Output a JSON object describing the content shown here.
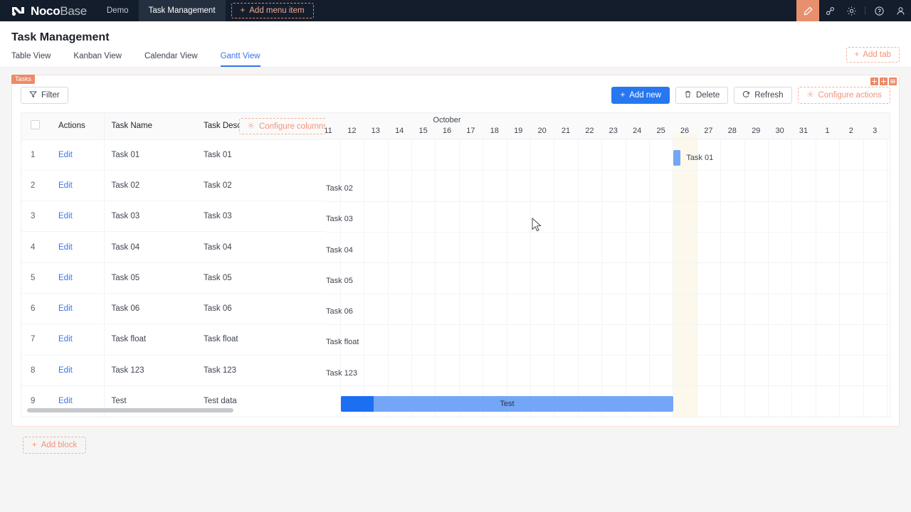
{
  "topnav": {
    "logo_primary": "Noco",
    "logo_secondary": "Base",
    "items": [
      {
        "label": "Demo",
        "active": false
      },
      {
        "label": "Task Management",
        "active": true
      }
    ],
    "add_menu_item": "Add menu item",
    "icons": [
      {
        "name": "design-pen-icon",
        "glyph": "✎",
        "highlighted": true
      },
      {
        "name": "plugin-icon",
        "glyph": "⚒",
        "highlighted": false
      },
      {
        "name": "gear-icon",
        "glyph": "⚙",
        "highlighted": false
      },
      {
        "name": "help-circle-icon",
        "glyph": "?",
        "highlighted": false
      },
      {
        "name": "user-avatar-icon",
        "glyph": "⚹",
        "highlighted": false
      }
    ]
  },
  "page": {
    "title": "Task Management",
    "tabs": [
      {
        "label": "Table View",
        "active": false
      },
      {
        "label": "Kanban View",
        "active": false
      },
      {
        "label": "Calendar View",
        "active": false
      },
      {
        "label": "Gantt View",
        "active": true
      }
    ],
    "add_tab": "Add tab"
  },
  "block": {
    "tag": "Tasks",
    "filter_label": "Filter",
    "actions": [
      {
        "label": "Add new",
        "style": "primary",
        "icon": "plus-icon"
      },
      {
        "label": "Delete",
        "style": "default",
        "icon": "trash-icon"
      },
      {
        "label": "Refresh",
        "style": "default",
        "icon": "refresh-icon"
      },
      {
        "label": "Configure actions",
        "style": "dashed-orange",
        "icon": "gear-icon"
      }
    ],
    "configure_columns": "Configure columns"
  },
  "table": {
    "columns": [
      "Actions",
      "Task Name",
      "Task Descrip"
    ],
    "rows": [
      {
        "index": "1",
        "action": "Edit",
        "name": "Task 01",
        "description": "Task 01"
      },
      {
        "index": "2",
        "action": "Edit",
        "name": "Task 02",
        "description": "Task 02"
      },
      {
        "index": "3",
        "action": "Edit",
        "name": "Task 03",
        "description": "Task 03"
      },
      {
        "index": "4",
        "action": "Edit",
        "name": "Task 04",
        "description": "Task 04"
      },
      {
        "index": "5",
        "action": "Edit",
        "name": "Task 05",
        "description": "Task 05"
      },
      {
        "index": "6",
        "action": "Edit",
        "name": "Task 06",
        "description": "Task 06"
      },
      {
        "index": "7",
        "action": "Edit",
        "name": "Task float",
        "description": "Task float"
      },
      {
        "index": "8",
        "action": "Edit",
        "name": "Task 123",
        "description": "Task 123"
      },
      {
        "index": "9",
        "action": "Edit",
        "name": "Test",
        "description": "Test data"
      }
    ]
  },
  "gantt": {
    "month_label": "October",
    "days": [
      "11",
      "12",
      "13",
      "14",
      "15",
      "16",
      "17",
      "18",
      "19",
      "20",
      "21",
      "22",
      "23",
      "24",
      "25",
      "26",
      "27",
      "28",
      "29",
      "30",
      "31",
      "1",
      "2",
      "3"
    ],
    "today_day": "26",
    "bars": [
      {
        "task": "Task 01",
        "start_day": "26",
        "span_days": 0.3,
        "progress": 0,
        "label_position": "right"
      },
      {
        "task": "Task 02",
        "start_day": "11",
        "span_days": 0,
        "progress": 0,
        "label_position": "right"
      },
      {
        "task": "Task 03",
        "start_day": "11",
        "span_days": 0,
        "progress": 0,
        "label_position": "right"
      },
      {
        "task": "Task 04",
        "start_day": "11",
        "span_days": 0,
        "progress": 0,
        "label_position": "right"
      },
      {
        "task": "Task 05",
        "start_day": "11",
        "span_days": 0,
        "progress": 0,
        "label_position": "right"
      },
      {
        "task": "Task 06",
        "start_day": "11",
        "span_days": 0,
        "progress": 0,
        "label_position": "right"
      },
      {
        "task": "Task float",
        "start_day": "11",
        "span_days": 0,
        "progress": 0,
        "label_position": "right"
      },
      {
        "task": "Task 123",
        "start_day": "11",
        "span_days": 0,
        "progress": 0,
        "label_position": "right"
      },
      {
        "task": "Test",
        "start_day": "12",
        "span_days": 14,
        "progress": 10,
        "label_position": "inside"
      }
    ],
    "colors": {
      "bar": "#74a6f7",
      "bar_progress": "#1d6ff2",
      "today_column": "#fcf8ec"
    }
  },
  "footer": {
    "add_block": "Add block"
  }
}
